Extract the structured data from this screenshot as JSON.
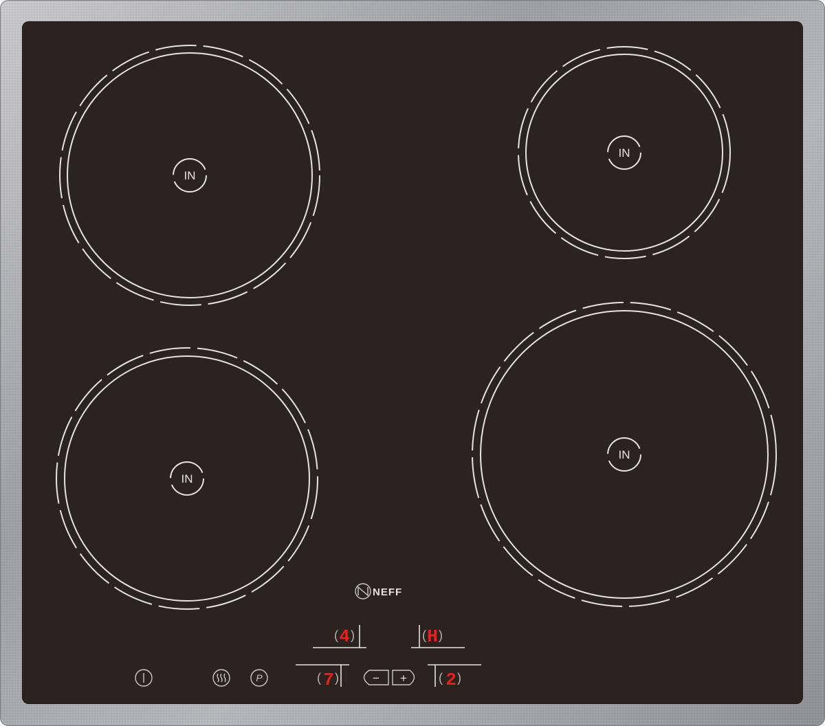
{
  "hob": {
    "brand": "NEFF",
    "zones": [
      {
        "id": "rear-left",
        "label": "IN"
      },
      {
        "id": "rear-right",
        "label": "IN"
      },
      {
        "id": "front-left",
        "label": "IN"
      },
      {
        "id": "front-right",
        "label": "IN"
      }
    ],
    "displays": {
      "rear_left": "4",
      "rear_right": "H",
      "front_left": "7",
      "front_right": "2"
    },
    "controls": {
      "minus_label": "−",
      "plus_label": "+",
      "power_label": "|",
      "keep_warm_label": "♨",
      "powerboost_label": "P"
    },
    "colors": {
      "glass": "#2c2220",
      "frame": "#a9aaae",
      "marking": "#e9e3e0",
      "display_red": "#e8201c"
    }
  }
}
